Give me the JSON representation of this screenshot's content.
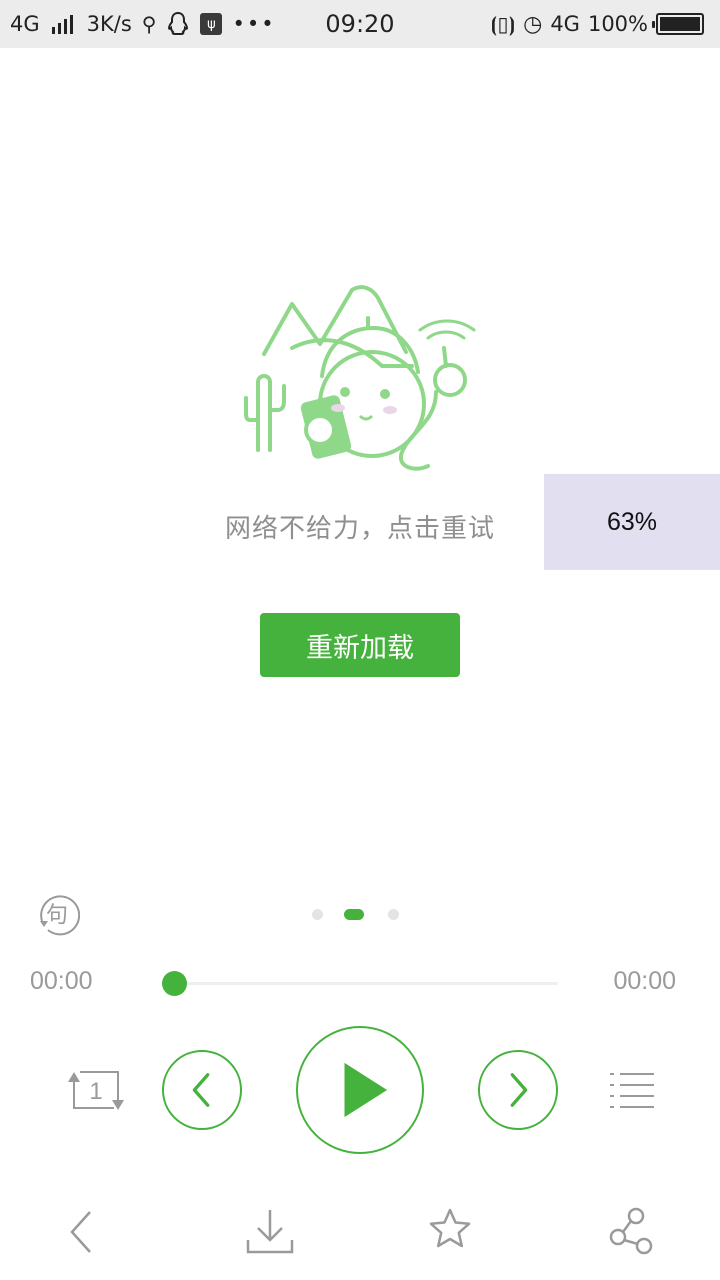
{
  "status_bar": {
    "network_left": "4G",
    "speed": "3K/s",
    "time": "09:20",
    "network_right": "4G",
    "battery": "100%"
  },
  "error": {
    "message": "网络不给力，点击重试",
    "reload_label": "重新加载"
  },
  "overlay": {
    "percent": "63%"
  },
  "player": {
    "current_time": "00:00",
    "total_time": "00:00",
    "progress": 0,
    "page_dots": 3,
    "active_page": 2,
    "repeat_badge": "1",
    "lyric_glyph": "句"
  },
  "colors": {
    "accent": "#45b23d",
    "illustration": "#8fd88a",
    "muted_text": "#8f8f8f",
    "overlay_bg": "#e1dff0"
  },
  "icons": {
    "lyric": "lyric-toggle-icon",
    "repeat": "repeat-one-icon",
    "prev": "chevron-left-icon",
    "play": "play-icon",
    "next": "chevron-right-icon",
    "playlist": "playlist-icon",
    "back": "back-arrow-icon",
    "download": "download-icon",
    "favorite": "star-icon",
    "share": "share-icon"
  }
}
